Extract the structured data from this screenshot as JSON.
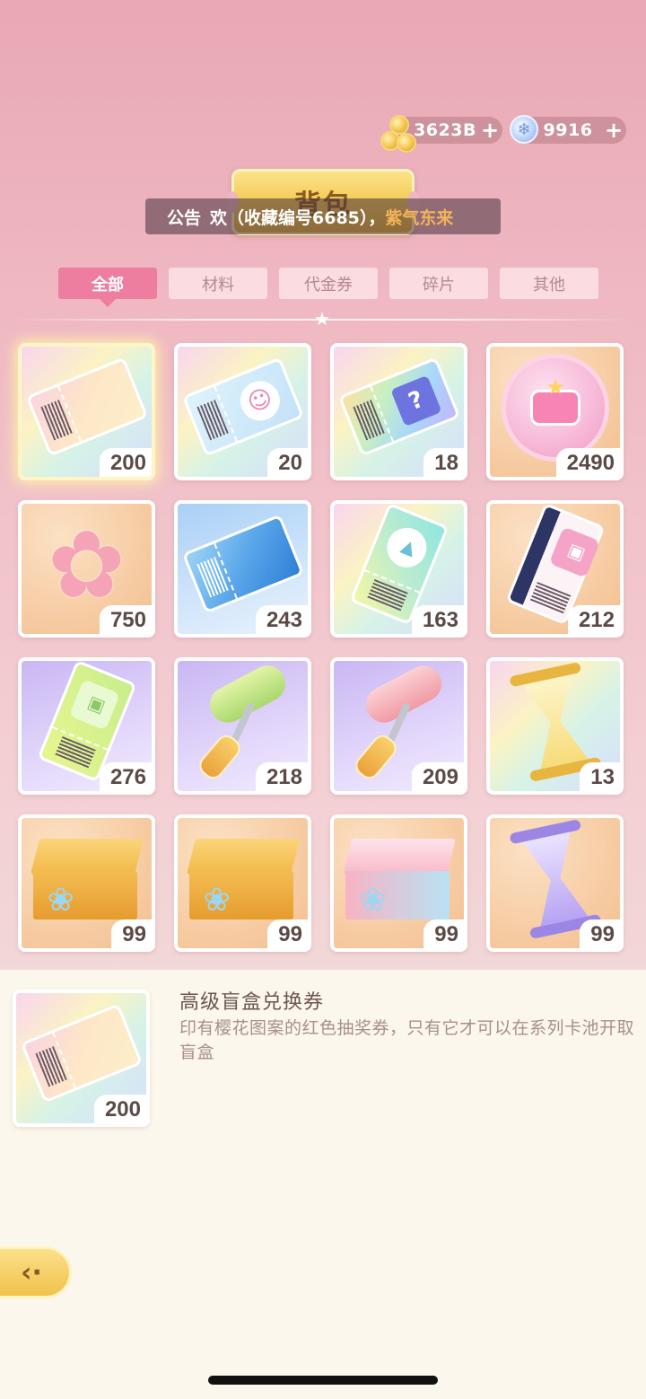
{
  "currency": {
    "coins": {
      "amount": "3623B",
      "icon": "gold-coin-icon"
    },
    "gems": {
      "amount": "9916",
      "icon": "snowflake-gem-icon"
    },
    "plus": "+"
  },
  "title": "背包",
  "announcement": {
    "label": "公告",
    "text": "欢（收藏编号6685），",
    "highlight": "紫气东来"
  },
  "tabs": [
    {
      "label": "全部",
      "active": true
    },
    {
      "label": "材料",
      "active": false
    },
    {
      "label": "代金券",
      "active": false
    },
    {
      "label": "碎片",
      "active": false
    },
    {
      "label": "其他",
      "active": false
    }
  ],
  "items": [
    {
      "icon": "premium-blind-box-ticket-icon",
      "count": "200"
    },
    {
      "icon": "avatar-ticket-icon",
      "count": "20"
    },
    {
      "icon": "mystery-ticket-icon",
      "count": "18"
    },
    {
      "icon": "pink-bag-medal-icon",
      "count": "2490"
    },
    {
      "icon": "sakura-flower-icon",
      "count": "750"
    },
    {
      "icon": "blue-ticket-icon",
      "count": "243"
    },
    {
      "icon": "video-ticket-icon",
      "count": "163"
    },
    {
      "icon": "dark-bag-ticket-icon",
      "count": "212"
    },
    {
      "icon": "green-bag-ticket-icon",
      "count": "276"
    },
    {
      "icon": "green-paint-roller-icon",
      "count": "218"
    },
    {
      "icon": "pink-paint-roller-icon",
      "count": "209"
    },
    {
      "icon": "golden-hourglass-icon",
      "count": "13"
    },
    {
      "icon": "golden-gift-box-icon",
      "count": "99"
    },
    {
      "icon": "golden-gift-box-icon",
      "count": "99"
    },
    {
      "icon": "pink-gift-box-icon",
      "count": "99"
    },
    {
      "icon": "purple-hourglass-icon",
      "count": "99"
    }
  ],
  "detail": {
    "name": "高级盲盒兑换券",
    "description": "印有樱花图案的红色抽奖券，只有它才可以在系列卡池开取盲盒",
    "count": "200"
  },
  "back_icon": "back-arrow-icon",
  "back_glyph": "‹·"
}
